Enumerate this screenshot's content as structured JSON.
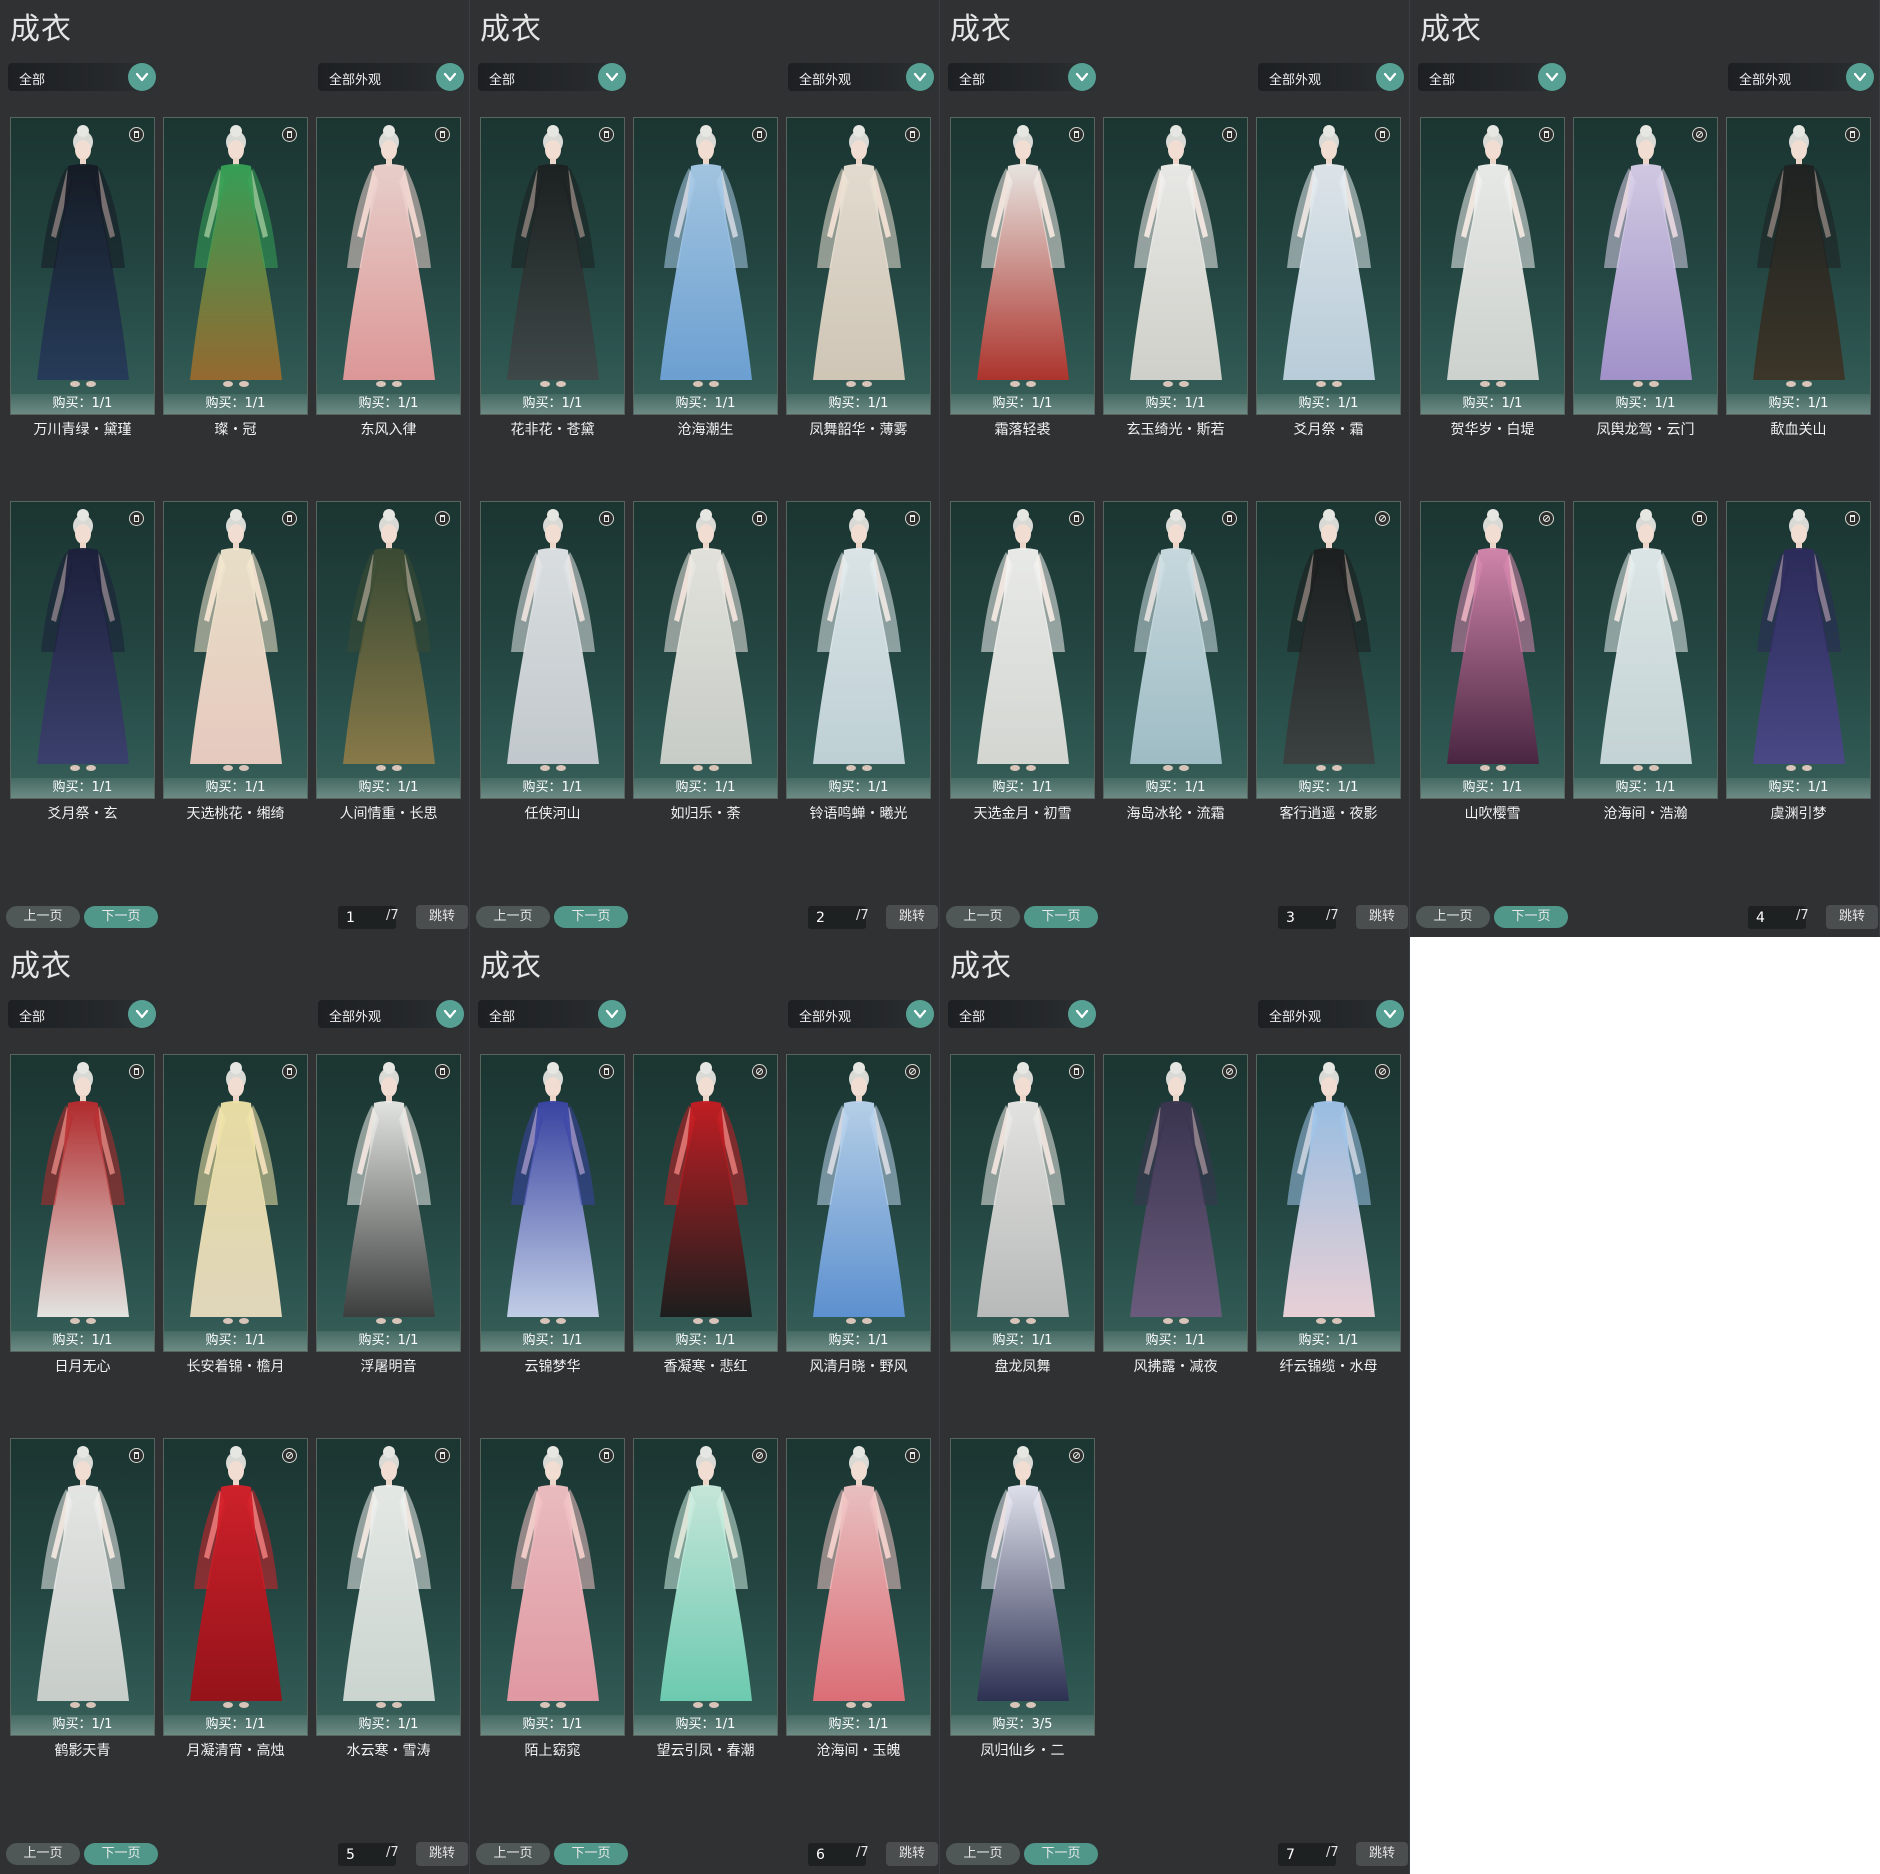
{
  "colors": {
    "panel_bg": "#2f3133",
    "accent_teal": "#57a194",
    "card_bg": "#22433f",
    "text": "#f2f2f2"
  },
  "panels": [
    {
      "title": "成衣",
      "filter_left": "全部",
      "filter_right": "全部外观",
      "prev": "上一页",
      "next": "下一页",
      "page": "1",
      "total": "/7",
      "jump": "跳转",
      "items": [
        {
          "name": "万川青绿・黛瑾",
          "buy": "购买：1/1",
          "icon": "trash-icon",
          "theme": [
            "#151a24",
            "#263a5a"
          ]
        },
        {
          "name": "璨・冠",
          "buy": "购买：1/1",
          "icon": "trash-icon",
          "theme": [
            "#36a357",
            "#9a6a2e"
          ]
        },
        {
          "name": "东风入律",
          "buy": "购买：1/1",
          "icon": "trash-icon",
          "theme": [
            "#f1d6d1",
            "#e59a9a"
          ]
        },
        {
          "name": "爻月祭・玄",
          "buy": "购买：1/1",
          "icon": "trash-icon",
          "theme": [
            "#1c1f3b",
            "#3b3f6e"
          ]
        },
        {
          "name": "天选桃花・缃绮",
          "buy": "购买：1/1",
          "icon": "trash-icon",
          "theme": [
            "#f2e7cf",
            "#f0cfc4"
          ]
        },
        {
          "name": "人间情重・长思",
          "buy": "购买：1/1",
          "icon": "trash-icon",
          "theme": [
            "#3a4a33",
            "#8c7b48"
          ]
        },
        {
          "name": "花非花・苍黛",
          "buy": "购买：1/1",
          "icon": "trash-icon",
          "theme": [
            "#1c2020",
            "#3f4747"
          ]
        },
        {
          "name": "沧海潮生",
          "buy": "购买：1/1",
          "icon": "trash-icon",
          "theme": [
            "#a8cbe8",
            "#6fa3d8"
          ]
        },
        {
          "name": "凤舞韶华・薄雾",
          "buy": "购买：1/1",
          "icon": "trash-icon",
          "theme": [
            "#ece3d6",
            "#d7cbbb"
          ]
        },
        {
          "name": "任侠河山",
          "buy": "购买：1/1",
          "icon": "trash-icon",
          "theme": [
            "#e3e6e8",
            "#c9ced3"
          ]
        },
        {
          "name": "如归乐・荼",
          "buy": "购买：1/1",
          "icon": "trash-icon",
          "theme": [
            "#eceae4",
            "#cfd2cc"
          ]
        },
        {
          "name": "铃语鸣蝉・曦光",
          "buy": "购买：1/1",
          "icon": "trash-icon",
          "theme": [
            "#e4ecef",
            "#c5d6db"
          ]
        }
      ]
    },
    {
      "title": "成衣",
      "filter_left": "全部",
      "filter_right": "全部外观",
      "prev": "上一页",
      "next": "下一页",
      "page": "2",
      "total": "/7",
      "jump": "跳转",
      "items": [
        {
          "name": "霜落轻裘",
          "buy": "购买：1/1",
          "icon": "trash-icon",
          "theme": [
            "#f1ece8",
            "#b2322a"
          ]
        },
        {
          "name": "玄玉绮光・斯若",
          "buy": "购买：1/1",
          "icon": "trash-icon",
          "theme": [
            "#f2f1ee",
            "#d8d6d0"
          ]
        },
        {
          "name": "爻月祭・霜",
          "buy": "购买：1/1",
          "icon": "trash-icon",
          "theme": [
            "#e6ecf1",
            "#bfd2e0"
          ]
        },
        {
          "name": "天选金月・初雪",
          "buy": "购买：1/1",
          "icon": "trash-icon",
          "theme": [
            "#f3f3f1",
            "#dcdcd8"
          ]
        },
        {
          "name": "海岛冰轮・流霜",
          "buy": "购买：1/1",
          "icon": "trash-icon",
          "theme": [
            "#cfe0e5",
            "#a4c1cb"
          ]
        },
        {
          "name": "客行逍遥・夜影",
          "buy": "购买：1/1",
          "icon": "locked-icon",
          "theme": [
            "#1b1d1d",
            "#3c4040"
          ]
        },
        {
          "name": "贺华岁・白堤",
          "buy": "购买：1/1",
          "icon": "trash-icon",
          "theme": [
            "#f1f2f0",
            "#d5d8d4"
          ]
        },
        {
          "name": "凤舆龙驾・云门",
          "buy": "购买：1/1",
          "icon": "locked-icon",
          "theme": [
            "#d9d0ea",
            "#a794cf"
          ]
        },
        {
          "name": "歃血关山",
          "buy": "购买：1/1",
          "icon": "trash-icon",
          "theme": [
            "#1e2120",
            "#3d3427"
          ]
        },
        {
          "name": "山吹樱雪",
          "buy": "购买：1/1",
          "icon": "locked-icon",
          "theme": [
            "#d989b0",
            "#4a2340"
          ]
        },
        {
          "name": "沧海间・浩瀚",
          "buy": "购买：1/1",
          "icon": "trash-icon",
          "theme": [
            "#e6eeef",
            "#cbd9db"
          ]
        },
        {
          "name": "虞渊引梦",
          "buy": "购买：1/1",
          "icon": "trash-icon",
          "theme": [
            "#2c2a5a",
            "#4b4788"
          ]
        }
      ]
    },
    {
      "title": "成衣",
      "filter_left": "全部",
      "filter_right": "全部外观",
      "prev": "上一页",
      "next": "下一页",
      "page": "3",
      "total": "/7",
      "jump": "跳转",
      "items": [
        {
          "name": "日月无心",
          "buy": "购买：1/1",
          "icon": "trash-icon",
          "theme": [
            "#b82a2c",
            "#ecebe8"
          ]
        },
        {
          "name": "长安着锦・檐月",
          "buy": "购买：1/1",
          "icon": "trash-icon",
          "theme": [
            "#f1e4a8",
            "#e9dcc0"
          ]
        },
        {
          "name": "浮屠明音",
          "buy": "购买：1/1",
          "icon": "trash-icon",
          "theme": [
            "#ecece9",
            "#3d3d3d"
          ]
        },
        {
          "name": "鹤影天青",
          "buy": "购买：1/1",
          "icon": "trash-icon",
          "theme": [
            "#eeeeec",
            "#cfd3d0"
          ]
        },
        {
          "name": "月凝清宵・高烛",
          "buy": "购买：1/1",
          "icon": "locked-icon",
          "theme": [
            "#d7202a",
            "#9a0f17"
          ]
        },
        {
          "name": "水云寒・雪涛",
          "buy": "购买：1/1",
          "icon": "trash-icon",
          "theme": [
            "#eef1ee",
            "#d3dbd6"
          ]
        },
        {
          "name": "云锦梦华",
          "buy": "购买：1/1",
          "icon": "trash-icon",
          "theme": [
            "#3a44a6",
            "#c9d4ee"
          ]
        },
        {
          "name": "香凝寒・悲红",
          "buy": "购买：1/1",
          "icon": "locked-icon",
          "theme": [
            "#c81d22",
            "#1b1b1b"
          ]
        },
        {
          "name": "风清月晓・野风",
          "buy": "购买：1/1",
          "icon": "locked-icon",
          "theme": [
            "#bcd6ef",
            "#5f93d6"
          ]
        }
      ]
    },
    {
      "title": "成衣",
      "filter_left": "全部",
      "filter_right": "全部外观",
      "prev": "上一页",
      "next": "下一页",
      "page": "4",
      "total": "/7",
      "jump": "跳转",
      "items": [
        {
          "name": "陌上窈窕",
          "buy": "购买：1/1",
          "icon": "trash-icon",
          "theme": [
            "#f3c2c6",
            "#e99ba6"
          ]
        },
        {
          "name": "望云引凤・春潮",
          "buy": "购买：1/1",
          "icon": "locked-icon",
          "theme": [
            "#cdeee1",
            "#6fd0b4"
          ]
        },
        {
          "name": "沧海间・玉魄",
          "buy": "购买：1/1",
          "icon": "trash-icon",
          "theme": [
            "#f2c6c6",
            "#e46f78"
          ]
        },
        {
          "name": "盘龙凤舞",
          "buy": "购买：1/1",
          "icon": "trash-icon",
          "theme": [
            "#ecebe8",
            "#bfbfbf"
          ]
        },
        {
          "name": "风拂露・减夜",
          "buy": "购买：1/1",
          "icon": "locked-icon",
          "theme": [
            "#3b3450",
            "#6d5b7e"
          ]
        },
        {
          "name": "纤云锦缆・水母",
          "buy": "购买：1/1",
          "icon": "locked-icon",
          "theme": [
            "#9fc4ea",
            "#f1d6dc"
          ]
        },
        {
          "name": "凤归仙乡・二",
          "buy": "购买：3/5",
          "icon": "locked-icon",
          "theme": [
            "#e7e8f3",
            "#2d2f52"
          ]
        }
      ]
    },
    {
      "title": "成衣",
      "filter_left": "全部",
      "filter_right": "全部外观",
      "prev": "上一页",
      "next": "下一页",
      "page": "5",
      "total": "/7",
      "jump": "跳转",
      "items": []
    },
    {
      "title": "成衣",
      "filter_left": "全部",
      "filter_right": "全部外观",
      "prev": "上一页",
      "next": "下一页",
      "page": "6",
      "total": "/7",
      "jump": "跳转",
      "items": []
    },
    {
      "title": "成衣",
      "filter_left": "全部",
      "filter_right": "全部外观",
      "prev": "上一页",
      "next": "下一页",
      "page": "7",
      "total": "/7",
      "jump": "跳转",
      "items": []
    }
  ]
}
